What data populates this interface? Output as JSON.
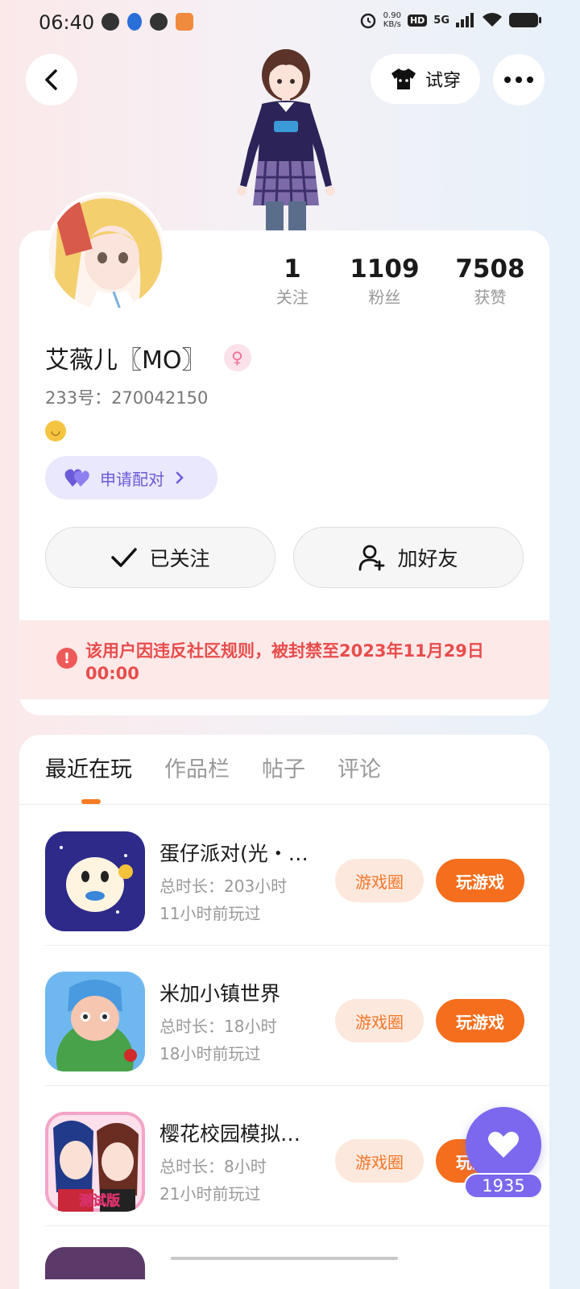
{
  "status_bar": {
    "time": "06:40",
    "net_speed_value": "0.90",
    "net_speed_unit": "KB/s",
    "hd": "HD",
    "network": "5G"
  },
  "header": {
    "try_on_label": "试穿"
  },
  "profile": {
    "stats": [
      {
        "value": "1",
        "label": "关注"
      },
      {
        "value": "1109",
        "label": "粉丝"
      },
      {
        "value": "7508",
        "label": "获赞"
      }
    ],
    "username": "艾薇儿〖MO〗",
    "uid": "233号：270042150",
    "pair_button": "申请配对",
    "follow_button": "已关注",
    "add_friend_button": "加好友",
    "ban_notice": "该用户因违反社区规则，被封禁至2023年11月29日 00:00"
  },
  "tabs": [
    "最近在玩",
    "作品栏",
    "帖子",
    "评论"
  ],
  "games": [
    {
      "name": "蛋仔派对(光・…",
      "total": "总时长：203小时",
      "last_played": "11小时前玩过",
      "circle_label": "游戏圈",
      "play_label": "玩游戏"
    },
    {
      "name": "米加小镇世界",
      "total": "总时长：18小时",
      "last_played": "18小时前玩过",
      "circle_label": "游戏圈",
      "play_label": "玩游戏"
    },
    {
      "name": "樱花校园模拟…",
      "total": "总时长：8小时",
      "last_played": "21小时前玩过",
      "circle_label": "游戏圈",
      "play_label": "玩游戏"
    }
  ],
  "game_icon_badge": "测试版",
  "like_count": "1935",
  "colors": {
    "accent_orange": "#f46e1d",
    "pair_purple": "#6b5bd8",
    "ban_red": "#e84d4d",
    "like_purple": "#7b68ee"
  }
}
